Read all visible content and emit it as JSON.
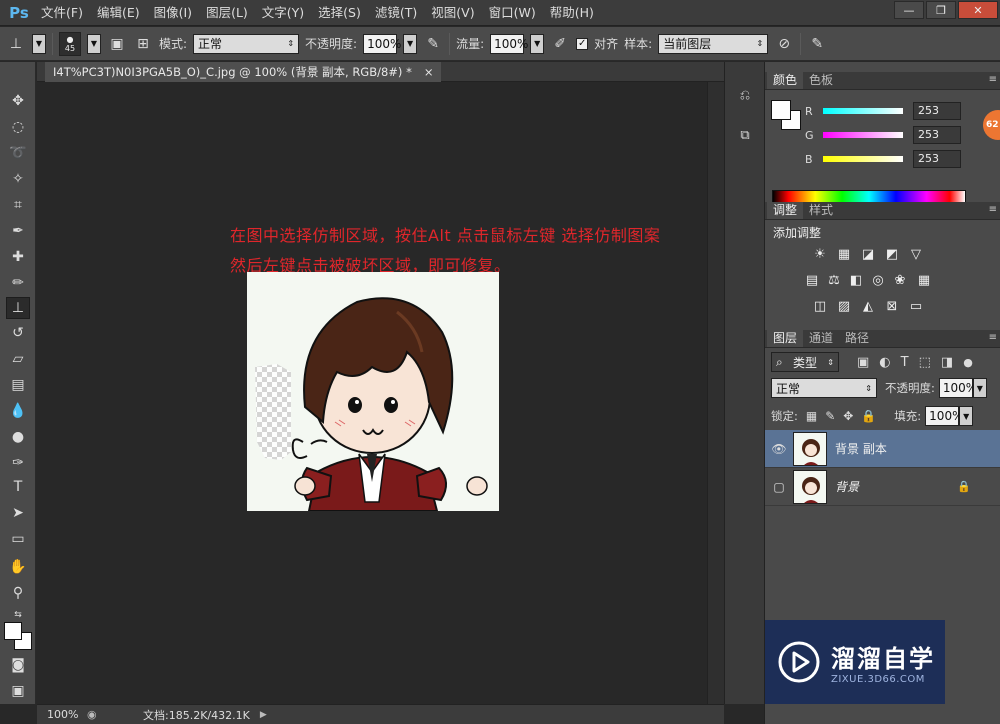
{
  "app": {
    "logo": "Ps"
  },
  "menu": [
    "文件(F)",
    "编辑(E)",
    "图像(I)",
    "图层(L)",
    "文字(Y)",
    "选择(S)",
    "滤镜(T)",
    "视图(V)",
    "窗口(W)",
    "帮助(H)"
  ],
  "options": {
    "brush_size": "45",
    "mode_label": "模式:",
    "mode_value": "正常",
    "opacity_label": "不透明度:",
    "opacity_value": "100%",
    "flow_label": "流量:",
    "flow_value": "100%",
    "align_label": "对齐",
    "sample_label": "样本:",
    "sample_value": "当前图层"
  },
  "document": {
    "tab_title": "I4T%PC3T)N0I3PGA5B_O)_C.jpg @ 100% (背景 副本, RGB/8#) *",
    "tab_close": "×",
    "note_line1": "在图中选择仿制区域，按住Alt 点击鼠标左键 选择仿制图案",
    "note_line2": "然后左键点击被破坏区域，即可修复。"
  },
  "status": {
    "zoom": "100%",
    "doc_size": "文档:185.2K/432.1K"
  },
  "color_panel": {
    "tabs": [
      "颜色",
      "色板"
    ],
    "r_label": "R",
    "g_label": "G",
    "b_label": "B",
    "r_value": "253",
    "g_value": "253",
    "b_value": "253",
    "badge": "62"
  },
  "adjust_panel": {
    "tabs": [
      "调整",
      "样式"
    ],
    "title": "添加调整"
  },
  "layers_panel": {
    "tabs": [
      "图层",
      "通道",
      "路径"
    ],
    "filter_label": "类型",
    "blend_mode": "正常",
    "opacity_label": "不透明度:",
    "opacity_value": "100%",
    "lock_label": "锁定:",
    "fill_label": "填充:",
    "fill_value": "100%",
    "layers": [
      {
        "name": "背景 副本",
        "selected": true
      },
      {
        "name": "背景",
        "selected": false
      }
    ]
  },
  "watermark": {
    "title": "溜溜自学",
    "subtitle": "ZIXUE.3D66.COM"
  },
  "colors": {
    "accent_selected": "#5a7395",
    "note_red": "#e0262b",
    "ps_blue": "#5db8f0"
  }
}
